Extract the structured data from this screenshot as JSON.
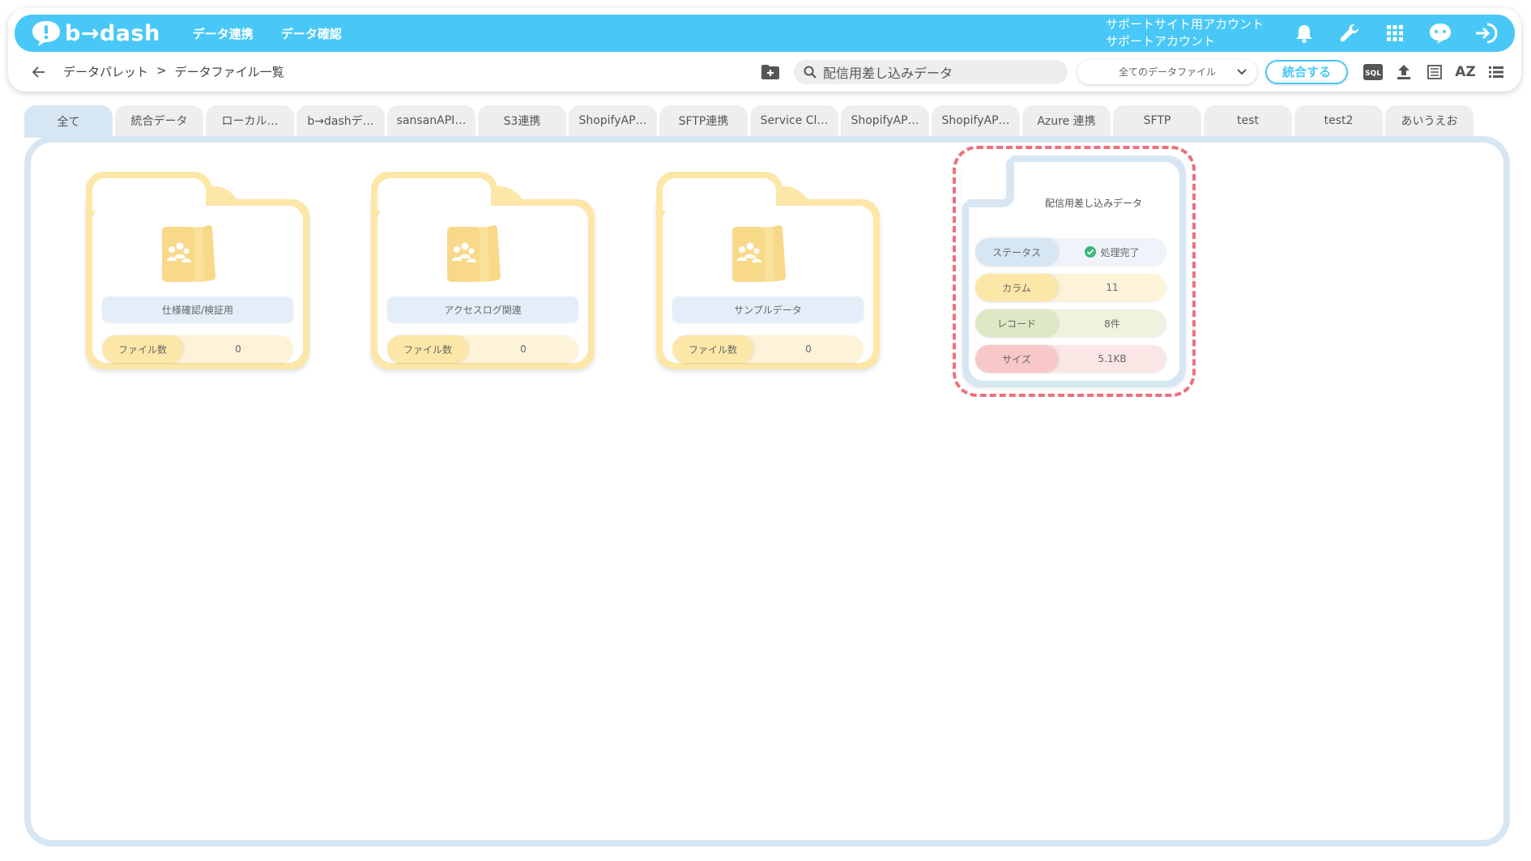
{
  "app": {
    "logo_text": "b→dash",
    "nav": [
      "データ連携",
      "データ確認"
    ],
    "account_line1": "サポートサイト用アカウント",
    "account_line2": "サポートアカウント"
  },
  "breadcrumb": {
    "items": [
      "データパレット",
      ">",
      "データファイル一覧"
    ]
  },
  "search": {
    "value": "配信用差し込みデータ",
    "placeholder": "配信用差し込みデータ"
  },
  "filter": {
    "selected": "全てのデータファイル"
  },
  "toolbar": {
    "merge_label": "統合する",
    "sql_label": "SQL",
    "sort_label": "AZ"
  },
  "tabs": [
    "全て",
    "統合データ",
    "ローカル…",
    "b→dashデ…",
    "sansanAPI…",
    "S3連携",
    "ShopifyAP…",
    "SFTP連携",
    "Service Cl…",
    "ShopifyAP…",
    "ShopifyAP…",
    "Azure 連携",
    "SFTP",
    "test",
    "test2",
    "あいうえお"
  ],
  "folders": [
    {
      "name": "仕様確認/検証用",
      "count_label": "ファイル数",
      "count": "0"
    },
    {
      "name": "アクセスログ関連",
      "count_label": "ファイル数",
      "count": "0"
    },
    {
      "name": "サンプルデータ",
      "count_label": "ファイル数",
      "count": "0"
    }
  ],
  "file_card": {
    "title": "配信用差し込みデータ",
    "status_label": "ステータス",
    "status_value": "処理完了",
    "column_label": "カラム",
    "column_value": "11",
    "record_label": "レコード",
    "record_value": "8件",
    "size_label": "サイズ",
    "size_value": "5.1KB"
  },
  "colors": {
    "brand": "#49c8f7",
    "folder": "#fce7a8",
    "panel": "#d6e6f3",
    "highlight": "#ef6f7d",
    "status_ok": "#3cb878"
  }
}
